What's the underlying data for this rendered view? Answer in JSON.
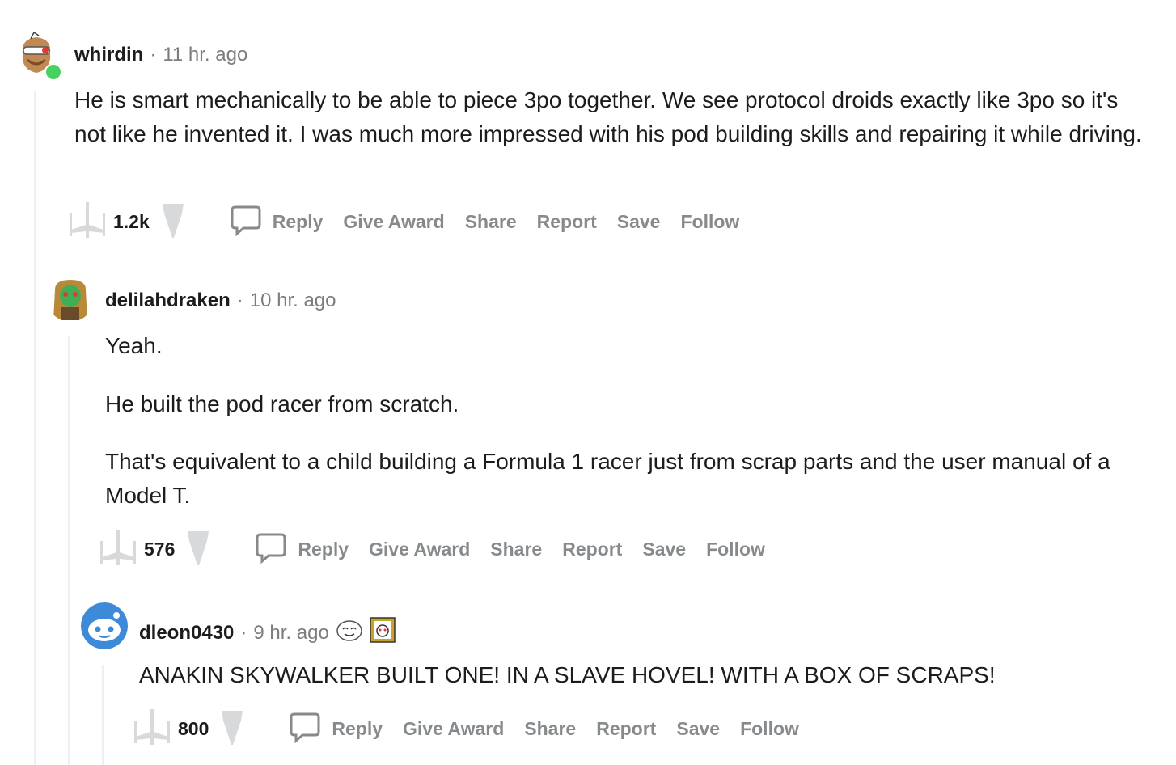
{
  "comments": [
    {
      "username": "whirdin",
      "separator": "·",
      "time": "11 hr. ago",
      "paragraphs": [
        "He is smart mechanically to be able to piece 3po together. We see protocol droids exactly like 3po so it's not like he invented it. I was much more impressed with his pod building skills and repairing it while driving."
      ],
      "score": "1.2k",
      "actions": {
        "reply": "Reply",
        "award": "Give Award",
        "share": "Share",
        "report": "Report",
        "save": "Save",
        "follow": "Follow"
      }
    },
    {
      "username": "delilahdraken",
      "separator": "·",
      "time": "10 hr. ago",
      "paragraphs": [
        "Yeah.",
        "He built the pod racer from scratch.",
        "That's equivalent to a child building a Formula 1 racer just from scrap parts and the user manual of a Model T."
      ],
      "score": "576",
      "actions": {
        "reply": "Reply",
        "award": "Give Award",
        "share": "Share",
        "report": "Report",
        "save": "Save",
        "follow": "Follow"
      }
    },
    {
      "username": "dleon0430",
      "separator": "·",
      "time": "9 hr. ago",
      "paragraphs": [
        "ANAKIN SKYWALKER BUILT ONE! IN A SLAVE HOVEL! WITH A BOX OF SCRAPS!"
      ],
      "score": "800",
      "actions": {
        "reply": "Reply",
        "award": "Give Award",
        "share": "Share",
        "report": "Report",
        "save": "Save",
        "follow": "Follow"
      }
    }
  ],
  "colors": {
    "muted": "#878a8c",
    "thread_line": "#edeff1",
    "online": "#46d160"
  }
}
